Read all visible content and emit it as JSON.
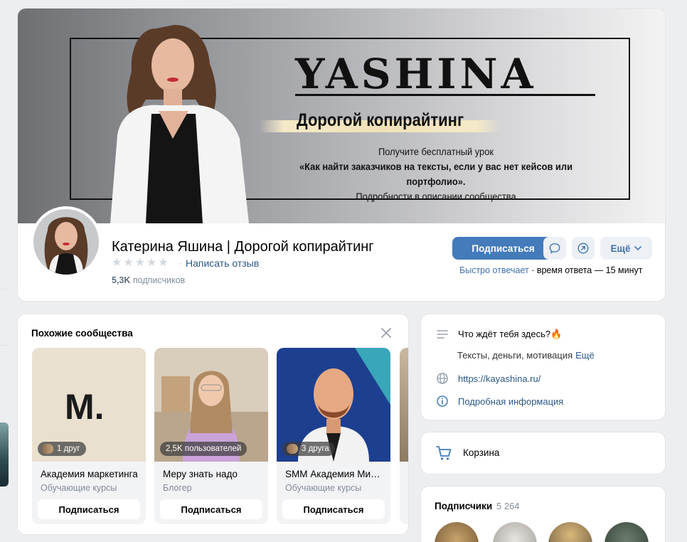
{
  "cover": {
    "brand": "YASHINA",
    "tagline": "Дорогой копирайтинг",
    "promo_line1": "Получите бесплатный урок",
    "promo_line2": "«Как найти заказчиков на тексты, если у вас нет кейсов или портфолио».",
    "promo_line3": "Подробности в описании сообщества"
  },
  "profile": {
    "name": "Катерина Яшина | Дорогой копирайтинг",
    "review_link": "Написать отзыв",
    "subscribers_count": "5,3K",
    "subscribers_label": "подписчиков",
    "subscribe_button": "Подписаться",
    "more_button": "Ещё",
    "response_fast": "Быстро отвечает",
    "response_time": "время ответа — 15 минут",
    "rating_stars": 0
  },
  "similar": {
    "title": "Похожие сообщества",
    "items": [
      {
        "badge": "1 друг",
        "name": "Академия маркетинга",
        "category": "Обучающие курсы",
        "button": "Подписаться",
        "logo_text": "M."
      },
      {
        "badge": "2,5K пользователей",
        "name": "Меру знать надо",
        "category": "Блогер",
        "button": "Подписаться"
      },
      {
        "badge": "3 друга",
        "name": "SMM Академия Ми…",
        "category": "Обучающие курсы",
        "button": "Подписаться"
      }
    ]
  },
  "info": {
    "description_title": "Что ждёт тебя здесь?🔥",
    "description_text": "Тексты, деньги, мотивация",
    "more": "Ещё",
    "website": "https://kayashina.ru/",
    "details": "Подробная информация"
  },
  "cart": {
    "label": "Корзина"
  },
  "followers": {
    "title": "Подписчики",
    "count": "5 264"
  },
  "colors": {
    "accent": "#447bba",
    "link": "#2a5885",
    "muted": "#818c99"
  }
}
